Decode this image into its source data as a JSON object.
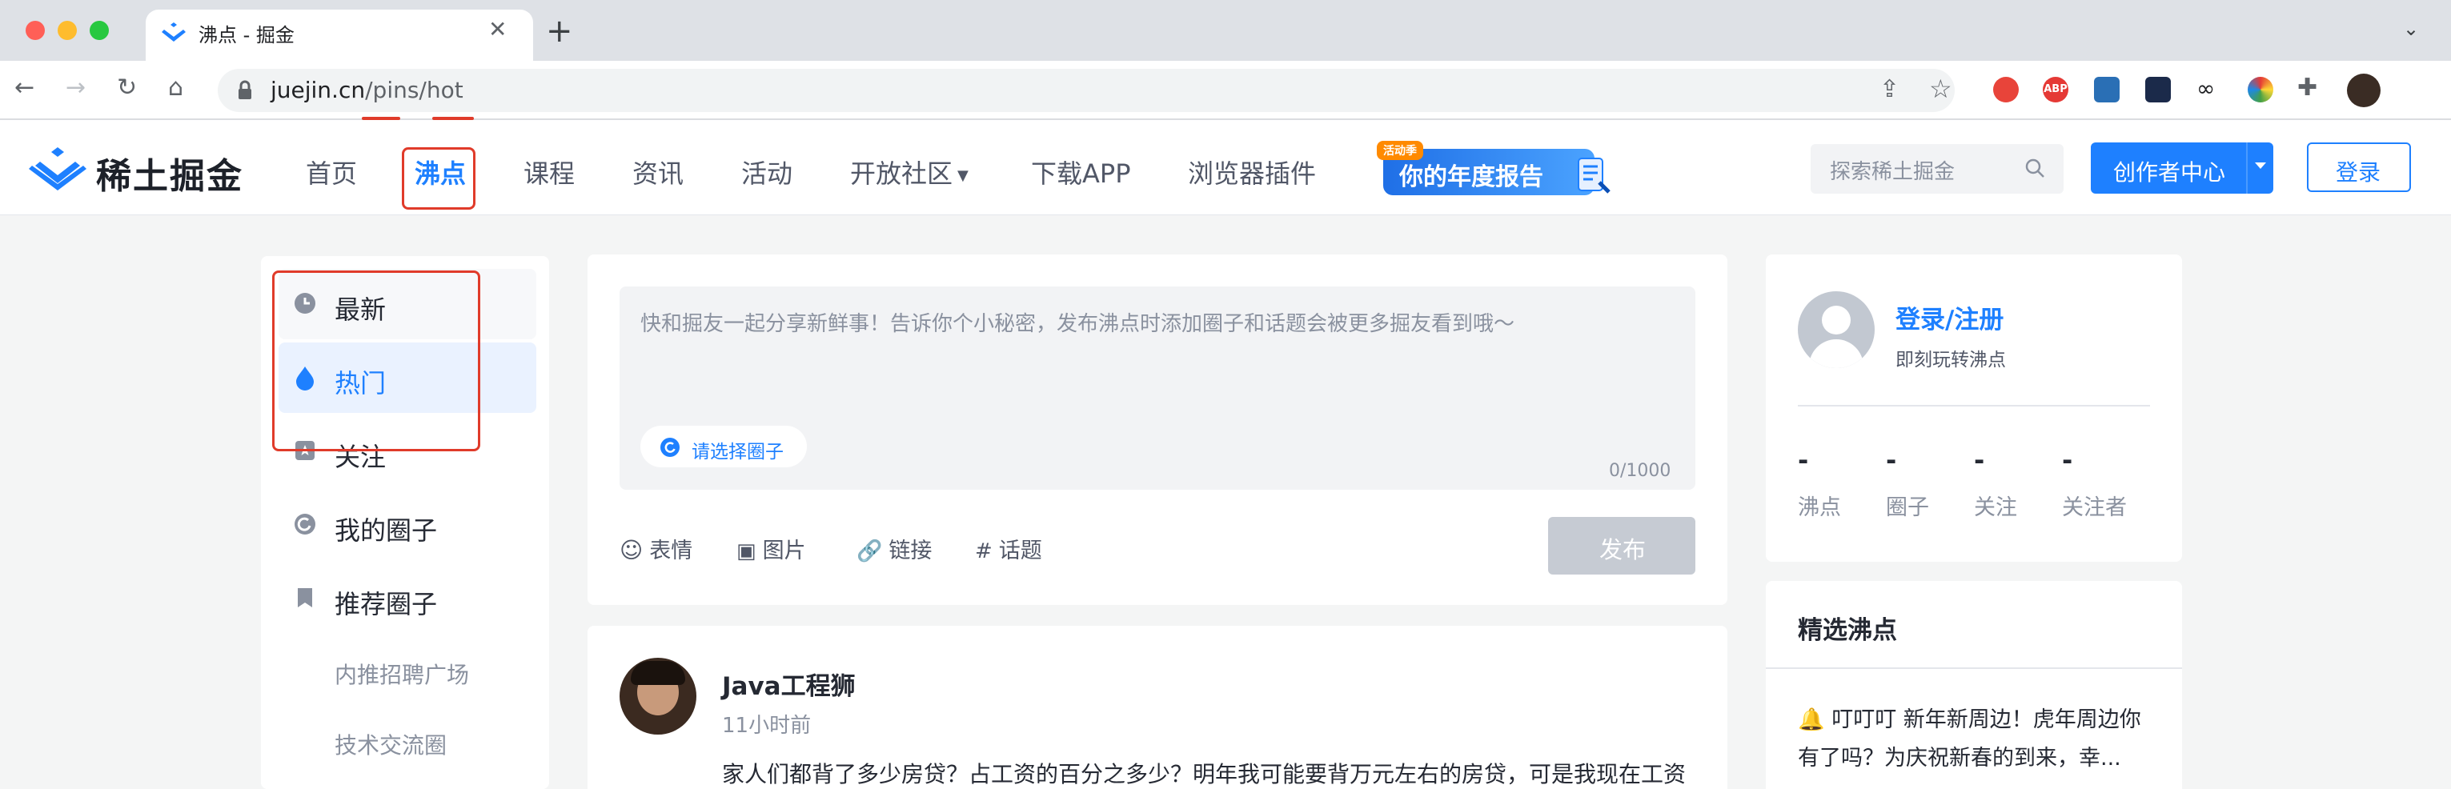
{
  "browser": {
    "tab_title": "沸点 - 掘金",
    "url_host": "juejin.cn",
    "url_path": "/pins/hot"
  },
  "header": {
    "logo_text": "稀土掘金",
    "nav": [
      "首页",
      "沸点",
      "课程",
      "资讯",
      "活动",
      "开放社区",
      "下载APP",
      "浏览器插件"
    ],
    "banner_badge": "活动季",
    "banner_text": "你的年度报告",
    "search_placeholder": "探索稀土掘金",
    "creator_label": "创作者中心",
    "login_label": "登录"
  },
  "sidebar": {
    "items": [
      "最新",
      "热门",
      "关注",
      "我的圈子",
      "推荐圈子"
    ],
    "sub_items": [
      "内推招聘广场",
      "技术交流圈"
    ]
  },
  "composer": {
    "placeholder": "快和掘友一起分享新鲜事！告诉你个小秘密，发布沸点时添加圈子和话题会被更多掘友看到哦～",
    "circle_chip": "请选择圈子",
    "char_count": "0/1000",
    "tools": [
      "表情",
      "图片",
      "链接",
      "话题"
    ],
    "publish_label": "发布"
  },
  "post": {
    "author": "Java工程狮",
    "time": "11小时前",
    "content": "家人们都背了多少房贷？占工资的百分之多少？明年我可能要背万元左右的房贷，可是我现在工资"
  },
  "profile_card": {
    "login_link": "登录/注册",
    "subtitle": "即刻玩转沸点",
    "stats": [
      {
        "value": "-",
        "label": "沸点"
      },
      {
        "value": "-",
        "label": "圈子"
      },
      {
        "value": "-",
        "label": "关注"
      },
      {
        "value": "-",
        "label": "关注者"
      }
    ]
  },
  "featured": {
    "title": "精选沸点",
    "text": "🔔 叮叮叮 新年新周边！虎年周边你有了吗？为庆祝新春的到来，幸..."
  },
  "colors": {
    "brand": "#1e80ff",
    "annotation": "#e03b2a"
  }
}
